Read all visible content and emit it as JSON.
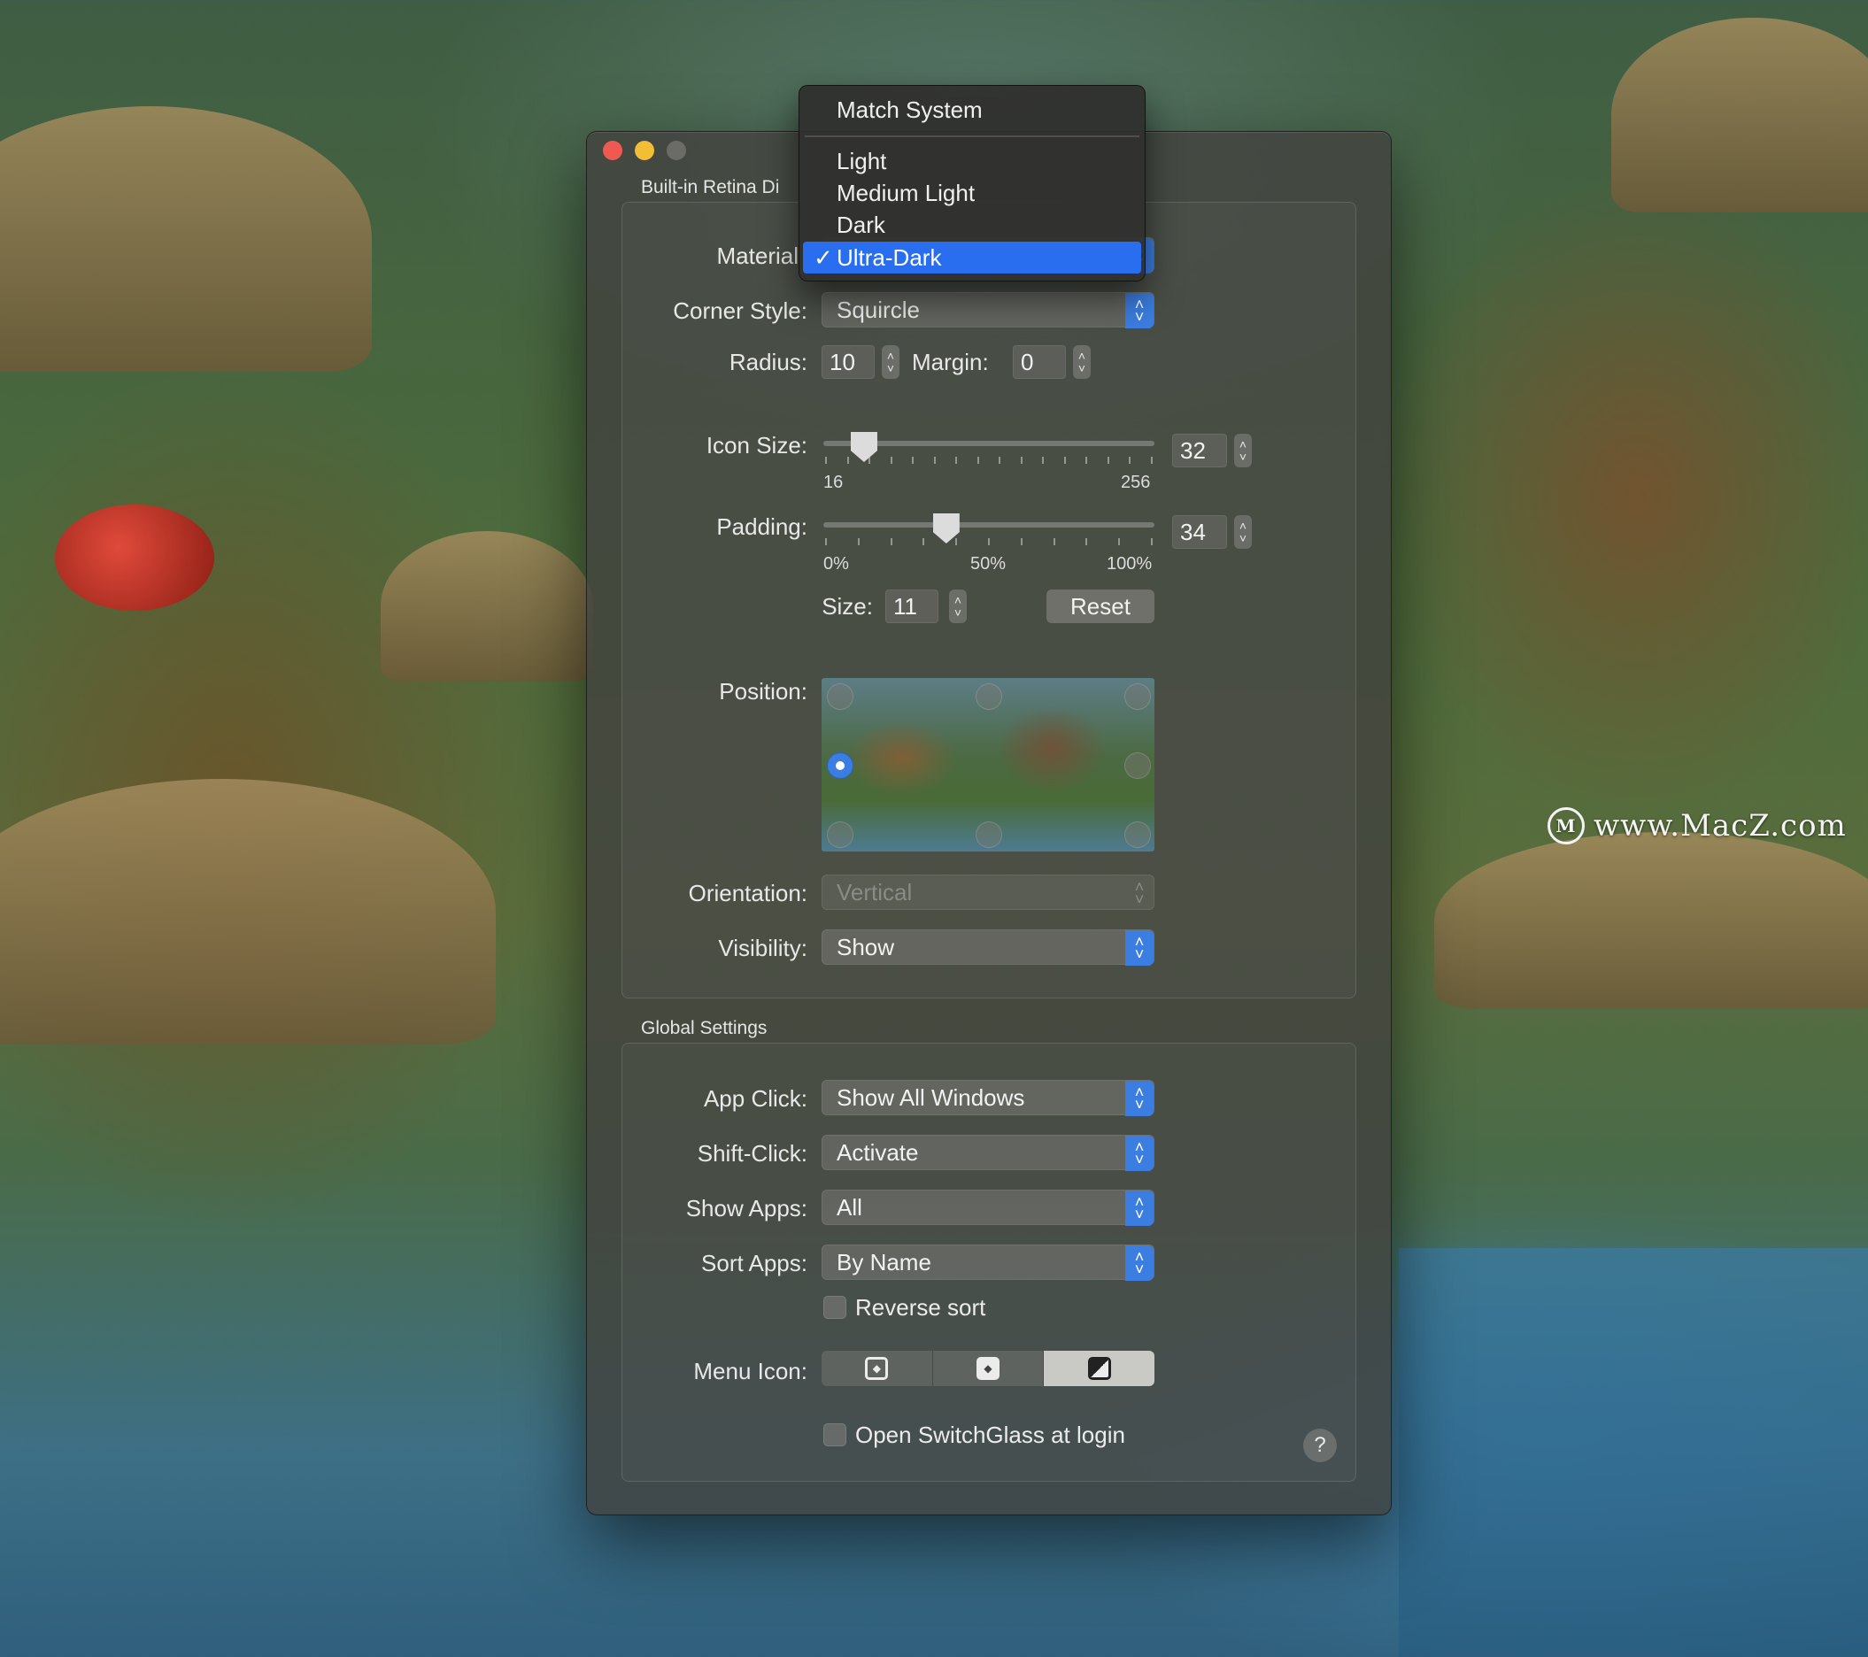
{
  "window": {
    "display_group_title": "Built-in Retina Di",
    "global_group_title": "Global Settings"
  },
  "material": {
    "label": "Material",
    "menu": {
      "items": [
        "Match System",
        "Light",
        "Medium Light",
        "Dark",
        "Ultra-Dark"
      ],
      "selected": "Ultra-Dark",
      "checkmark": "✓"
    }
  },
  "corner_style": {
    "label": "Corner Style:",
    "value": "Squircle"
  },
  "radius": {
    "label": "Radius:",
    "value": "10"
  },
  "margin": {
    "label": "Margin:",
    "value": "0"
  },
  "icon_size": {
    "label": "Icon Size:",
    "value": "32",
    "slider_position": 0.09,
    "min_label": "16",
    "max_label": "256"
  },
  "padding": {
    "label": "Padding:",
    "value": "34",
    "slider_position": 0.36,
    "ticks": [
      "0%",
      "50%",
      "100%"
    ]
  },
  "size": {
    "label": "Size:",
    "value": "11"
  },
  "reset_button": "Reset",
  "position": {
    "label": "Position:",
    "selected": "middle-left"
  },
  "orientation": {
    "label": "Orientation:",
    "value": "Vertical",
    "disabled": true
  },
  "visibility": {
    "label": "Visibility:",
    "value": "Show"
  },
  "app_click": {
    "label": "App Click:",
    "value": "Show All Windows"
  },
  "shift_click": {
    "label": "Shift-Click:",
    "value": "Activate"
  },
  "show_apps": {
    "label": "Show Apps:",
    "value": "All"
  },
  "sort_apps": {
    "label": "Sort Apps:",
    "value": "By Name"
  },
  "reverse_sort": {
    "label": "Reverse sort",
    "checked": false
  },
  "menu_icon": {
    "label": "Menu Icon:",
    "options": [
      "outline-diamond-icon",
      "filled-diamond-icon",
      "half-square-icon"
    ],
    "selected": 2
  },
  "open_at_login": {
    "label": "Open SwitchGlass at login",
    "checked": false
  },
  "help": "?",
  "watermark": "www.MacZ.com",
  "colors": {
    "accent": "#3b7de0",
    "menu_highlight": "#2a6ef0",
    "close": "#ee5a52",
    "minimize": "#f2be35"
  }
}
